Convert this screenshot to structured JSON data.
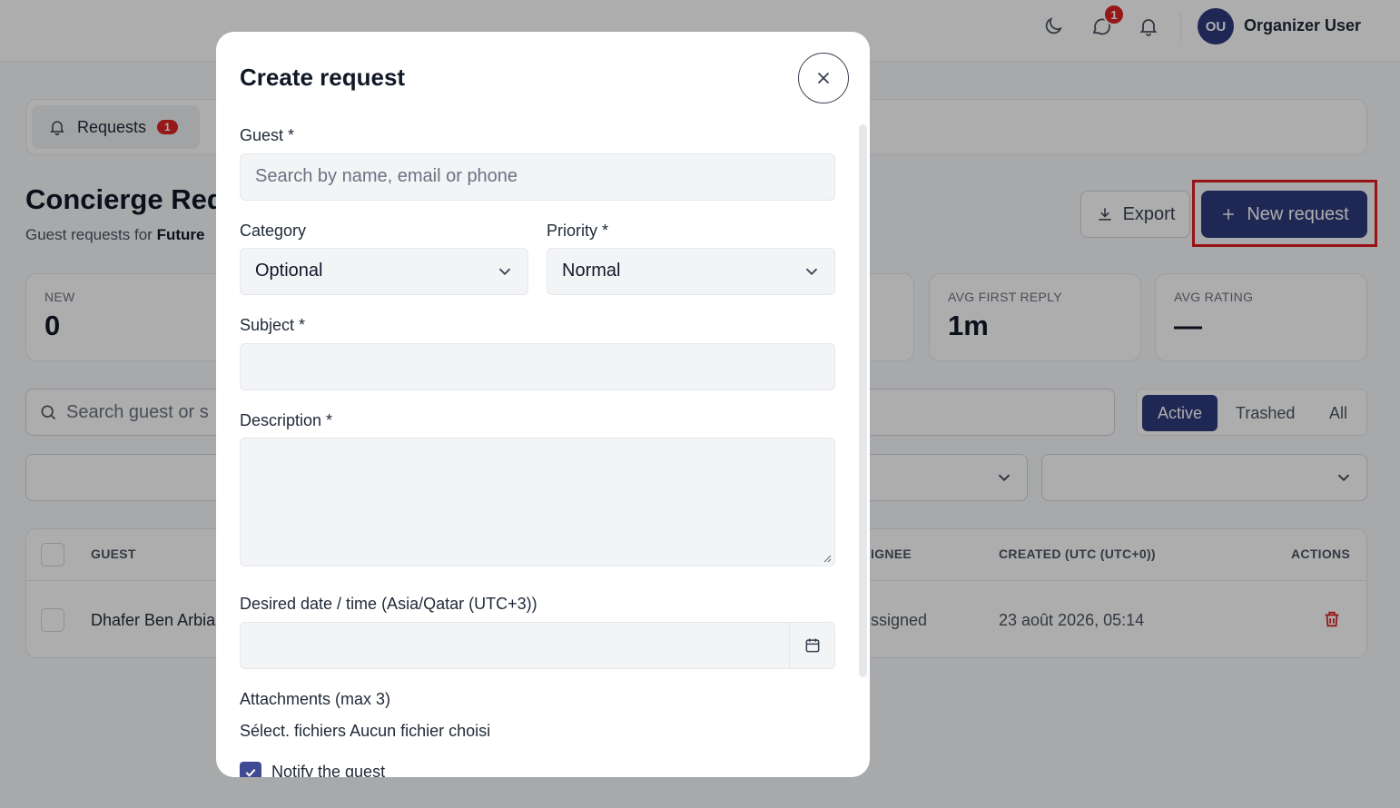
{
  "topbar": {
    "chat_badge": "1",
    "user_initials": "OU",
    "user_name": "Organizer User"
  },
  "tabs": {
    "requests_label": "Requests",
    "requests_badge": "1"
  },
  "page": {
    "title": "Concierge Req",
    "subtitle_prefix": "Guest requests for ",
    "subtitle_bold": "Future"
  },
  "actions": {
    "export_label": "Export",
    "new_request_label": "New request"
  },
  "stats": [
    {
      "label": "NEW",
      "value": "0"
    },
    {
      "label": "AVG FIRST REPLY",
      "value": "1m"
    },
    {
      "label": "AVG RATING",
      "value": "—"
    }
  ],
  "search": {
    "placeholder": "Search guest or s"
  },
  "view_filter": {
    "options": [
      "Active",
      "Trashed",
      "All"
    ],
    "selected": "Active"
  },
  "table": {
    "headers": {
      "guest": "GUEST",
      "assignee": "IGNEE",
      "created": "CREATED (UTC (UTC+0))",
      "actions": "ACTIONS"
    },
    "rows": [
      {
        "guest": "Dhafer Ben Arbia",
        "assignee": "ssigned",
        "created": "23 août 2026, 05:14"
      }
    ]
  },
  "modal": {
    "title": "Create request",
    "guest_label": "Guest *",
    "guest_placeholder": "Search by name, email or phone",
    "category_label": "Category",
    "category_value": "Optional",
    "priority_label": "Priority *",
    "priority_value": "Normal",
    "subject_label": "Subject *",
    "description_label": "Description *",
    "date_label": "Desired date / time (Asia/Qatar (UTC+3))",
    "attachments_label": "Attachments (max 3)",
    "file_button": "Sélect. fichiers",
    "file_status": "Aucun fichier choisi",
    "notify_label": "Notify the guest",
    "notify_checked": true
  },
  "colors": {
    "primary": "#2f3a7e",
    "danger": "#dc2626",
    "highlight": "#e11d1d"
  }
}
